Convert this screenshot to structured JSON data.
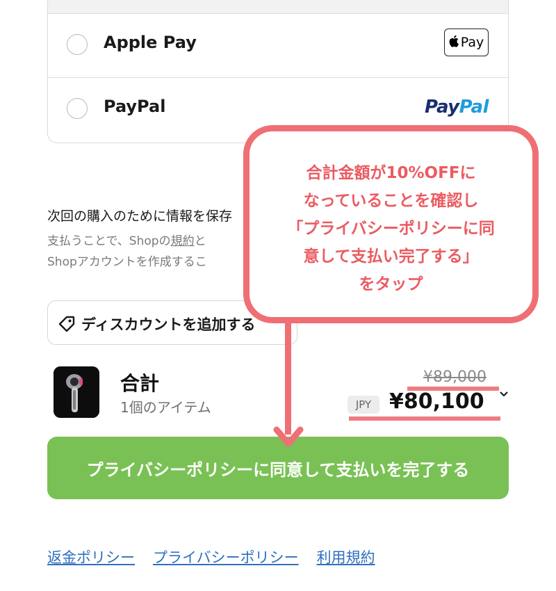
{
  "payment_methods": [
    {
      "label": "Apple Pay",
      "badge": "Pay"
    },
    {
      "label": "PayPal",
      "logo_part1": "Pay",
      "logo_part2": "Pal"
    }
  ],
  "save_info": {
    "title": "次回の購入のために情報を保存",
    "desc_line1_start": "支払うことで、Shopの",
    "desc_link_terms": "規約",
    "desc_line1_end": "と",
    "desc_line2": "Shopアカウントを作成するこ"
  },
  "discount": {
    "label": "ディスカウントを追加する"
  },
  "summary": {
    "total_label": "合計",
    "item_count": "1個のアイテム",
    "original_price": "¥89,000",
    "currency": "JPY",
    "final_price": "¥80,100"
  },
  "pay_button": {
    "label": "プライバシーポリシーに同意して支払いを完了する"
  },
  "footer": {
    "refund": "返金ポリシー",
    "privacy": "プライバシーポリシー",
    "terms": "利用規約"
  },
  "callout": {
    "line1": "合計金額が10%OFFに",
    "line2": "なっていることを確認し",
    "line3": "「プライバシーポリシーに同",
    "line4": "意して支払い完了する」",
    "line5": "をタップ"
  },
  "colors": {
    "accent_green": "#79c155",
    "annotation_red": "#ef6f74",
    "link_blue": "#2f6fbf"
  },
  "icons": [
    "apple-icon",
    "tag-icon",
    "chevron-down-icon",
    "arrow-down-icon"
  ]
}
